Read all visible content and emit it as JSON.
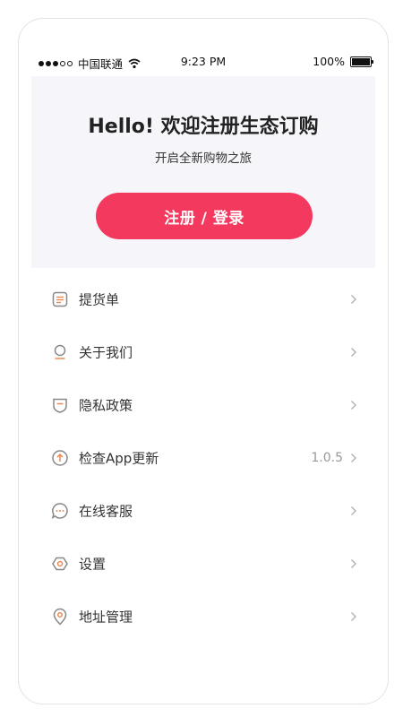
{
  "status_bar": {
    "carrier": "中国联通",
    "time": "9:23 PM",
    "battery": "100%"
  },
  "hero": {
    "title": "Hello! 欢迎注册生态订购",
    "subtitle": "开启全新购物之旅",
    "login_button": "注册 / 登录"
  },
  "menu": {
    "items": [
      {
        "label": "提货单",
        "icon": "document-icon",
        "value": ""
      },
      {
        "label": "关于我们",
        "icon": "info-icon",
        "value": ""
      },
      {
        "label": "隐私政策",
        "icon": "shield-icon",
        "value": ""
      },
      {
        "label": "检查App更新",
        "icon": "upload-icon",
        "value": "1.0.5"
      },
      {
        "label": "在线客服",
        "icon": "chat-icon",
        "value": ""
      },
      {
        "label": "设置",
        "icon": "gear-icon",
        "value": ""
      },
      {
        "label": "地址管理",
        "icon": "location-icon",
        "value": ""
      }
    ]
  },
  "colors": {
    "accent": "#f4395f",
    "hero_background": "#f6f6fa",
    "icon_outline": "#888888",
    "icon_accent": "#e88a52"
  }
}
